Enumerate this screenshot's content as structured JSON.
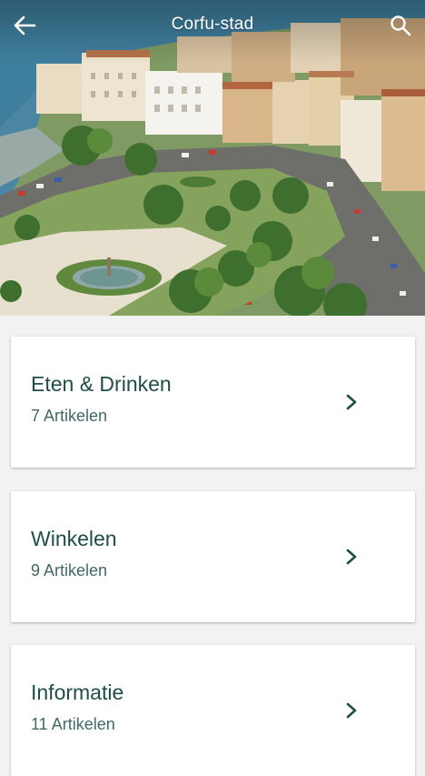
{
  "header": {
    "title": "Corfu-stad",
    "back_icon": "arrow-left-icon",
    "search_icon": "search-icon"
  },
  "hero": {
    "description_icon": "city-photo"
  },
  "categories": [
    {
      "title": "Eten & Drinken",
      "count": "7 Artikelen",
      "icon": "chevron-right-icon"
    },
    {
      "title": "Winkelen",
      "count": "9 Artikelen",
      "icon": "chevron-right-icon"
    },
    {
      "title": "Informatie",
      "count": "11 Artikelen",
      "icon": "chevron-right-icon"
    }
  ],
  "colors": {
    "accent": "#1f4e47",
    "subtext": "#3f6b64",
    "background": "#f2f2f2",
    "card": "#ffffff"
  }
}
